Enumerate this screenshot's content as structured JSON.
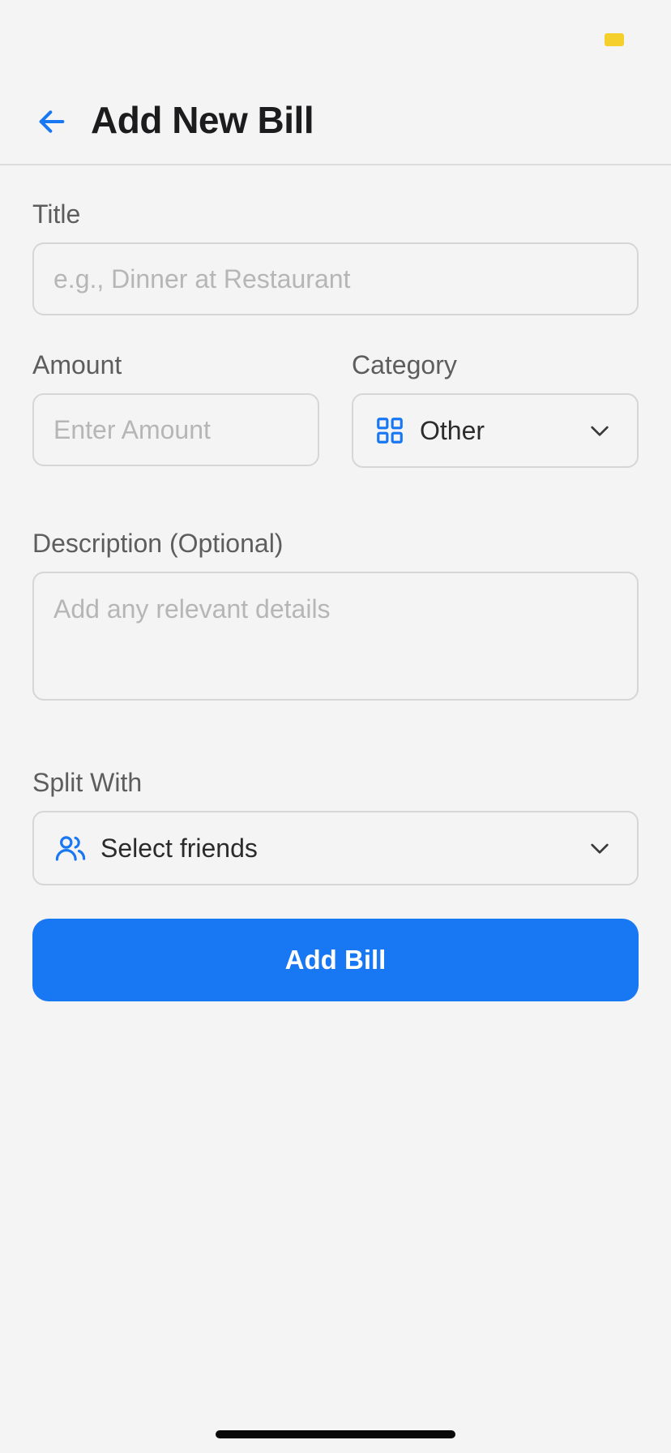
{
  "colors": {
    "accent": "#1877F2",
    "status_indicator": "#F5CF2C",
    "background": "#F4F4F4"
  },
  "header": {
    "title": "Add New Bill",
    "back_icon": "arrow-left-icon"
  },
  "form": {
    "title": {
      "label": "Title",
      "value": "",
      "placeholder": "e.g., Dinner at Restaurant"
    },
    "amount": {
      "label": "Amount",
      "value": "",
      "placeholder": "Enter Amount"
    },
    "category": {
      "label": "Category",
      "selected": "Other",
      "icon": "grid-icon"
    },
    "description": {
      "label": "Description (Optional)",
      "value": "",
      "placeholder": "Add any relevant details"
    },
    "split_with": {
      "label": "Split With",
      "selected": "Select friends",
      "icon": "users-icon"
    }
  },
  "actions": {
    "submit_label": "Add Bill"
  }
}
